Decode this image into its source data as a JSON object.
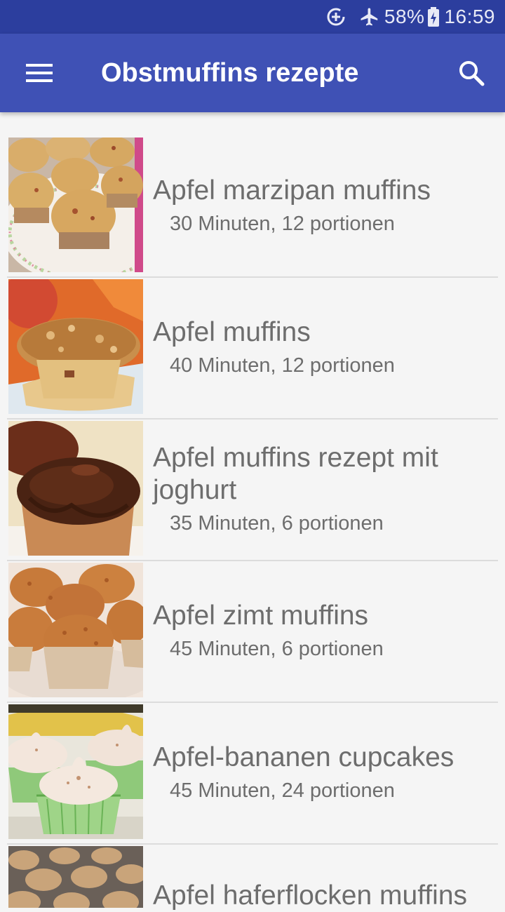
{
  "status_bar": {
    "battery": "58%",
    "time": "16:59"
  },
  "app_bar": {
    "title": "Obstmuffins rezepte"
  },
  "recipes": [
    {
      "title": "Apfel marzipan muffins",
      "subtitle": "30 Minuten, 12 portionen"
    },
    {
      "title": "Apfel muffins",
      "subtitle": "40 Minuten, 12 portionen"
    },
    {
      "title": "Apfel muffins rezept mit joghurt",
      "subtitle": "35 Minuten, 6 portionen"
    },
    {
      "title": "Apfel zimt muffins",
      "subtitle": "45 Minuten, 6 portionen"
    },
    {
      "title": "Apfel-bananen cupcakes",
      "subtitle": "45 Minuten, 24 portionen"
    },
    {
      "title": "Apfel haferflocken muffins",
      "subtitle": ""
    }
  ]
}
